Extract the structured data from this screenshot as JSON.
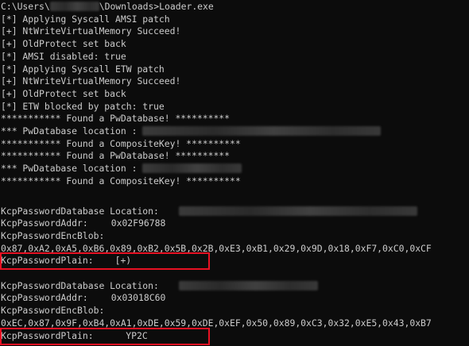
{
  "console": {
    "prompt_prefix": "C:\\Users\\",
    "prompt_suffix": "\\Downloads>Loader.exe",
    "lines": [
      "[*] Applying Syscall AMSI patch",
      "[+] NtWriteVirtualMemory Succeed!",
      "[+] OldProtect set back",
      "[*] AMSI disabled: true",
      "[*] Applying Syscall ETW patch",
      "[+] NtWriteVirtualMemory Succeed!",
      "[+] OldProtect set back",
      "[*] ETW blocked by patch: true",
      "*********** Found a PwDatabase! **********",
      "*** PwDatabase location : ",
      "*********** Found a CompositeKey! **********",
      "*********** Found a PwDatabase! **********",
      "*** PwDatabase location : ",
      "*********** Found a CompositeKey! **********"
    ],
    "block1": {
      "db_location_label": "KcpPasswordDatabase Location:",
      "addr_label": "KcpPasswordAddr:",
      "addr_value": "0x02F96788",
      "encblob_label": "KcpPasswordEncBlob:",
      "encblob_value": "0x87,0xA2,0xA5,0xB6,0x89,0xB2,0x5B,0x2B,0xE3,0xB1,0x29,0x9D,0x18,0xF7,0xC0,0xCF",
      "plain_label": "KcpPasswordPlain:",
      "plain_value": "[+)"
    },
    "block2": {
      "db_location_label": "KcpPasswordDatabase Location:",
      "addr_label": "KcpPasswordAddr:",
      "addr_value": "0x03018C60",
      "encblob_label": "KcpPasswordEncBlob:",
      "encblob_value": "0xEC,0x87,0x9F,0xB4,0xA1,0xDE,0x59,0xDE,0xEF,0x50,0x89,0xC3,0x32,0xE5,0x43,0xB7",
      "plain_label": "KcpPasswordPlain:",
      "plain_value": "  YP2C"
    }
  },
  "colors": {
    "background": "#0c0c0c",
    "text": "#cccccc",
    "highlight_border": "#e81123"
  }
}
